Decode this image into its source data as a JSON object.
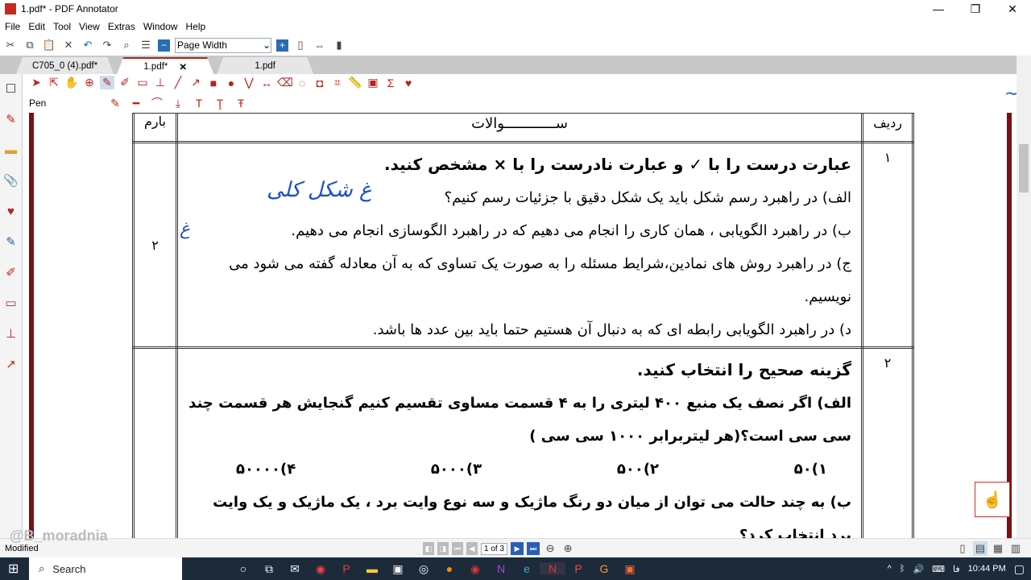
{
  "window": {
    "title": "1.pdf* - PDF Annotator",
    "minimize": "—",
    "restore": "❐",
    "close": "✕"
  },
  "menu": [
    "File",
    "Edit",
    "Tool",
    "View",
    "Extras",
    "Window",
    "Help"
  ],
  "toolbar": {
    "zoom_mode": "Page Width"
  },
  "tabs": [
    {
      "label": "C705_0 (4).pdf*"
    },
    {
      "label": "1.pdf*",
      "close": "✕"
    },
    {
      "label": "1.pdf"
    }
  ],
  "annotation": {
    "current_tool": "Pen"
  },
  "document": {
    "header": {
      "row": "ردیف",
      "questions": "ســــــــــــوالات",
      "score": "بارم"
    },
    "q1": {
      "num": "۱",
      "score": "۲",
      "title": "عبارت درست را با ✓ و عبارت نادرست را با × مشخص کنید.",
      "a": "الف) در راهبرد رسم شکل باید یک شکل دقیق با جزئیات رسم کنیم؟",
      "b": "ب) در راهبرد الگویابی ، همان کاری را انجام می دهیم که در راهبرد الگوسازی انجام می دهیم.",
      "c": "ج) در راهبرد روش های نمادین،شرایط مسئله را به صورت یک تساوی که به آن معادله گفته می شود می نویسیم.",
      "d": "د) در راهبرد الگویابی رابطه ای که به دنبال آن هستیم حتما باید بین عدد ها باشد.",
      "handwriting_a": "غ  شکل کلی",
      "handwriting_b": "غ"
    },
    "q2": {
      "num": "۲",
      "title": "گزینه صحیح را انتخاب کنید.",
      "a": "الف) اگر نصف یک منبع ۴۰۰ لیتری را به ۴ قسمت مساوی تقسیم کنیم گنجایش هر قسمت چند سی سی است؟(هر لیتربرابر ۱۰۰۰ سی سی )",
      "options": [
        "۱)۵۰",
        "۲)۵۰۰",
        "۳)۵۰۰۰",
        "۴)۵۰۰۰۰"
      ],
      "b": "ب) به چند حالت می توان از میان دو رنگ ماژیک و سه نوع وایت برد ، یک ماژیک و یک وایت برد انتخاب کرد؟"
    }
  },
  "watermark": "@B_moradnia",
  "status": {
    "text": "Modified",
    "page": "1 of 3"
  },
  "taskbar": {
    "search": "Search",
    "time": "10:44 PM",
    "lang": "فا"
  }
}
